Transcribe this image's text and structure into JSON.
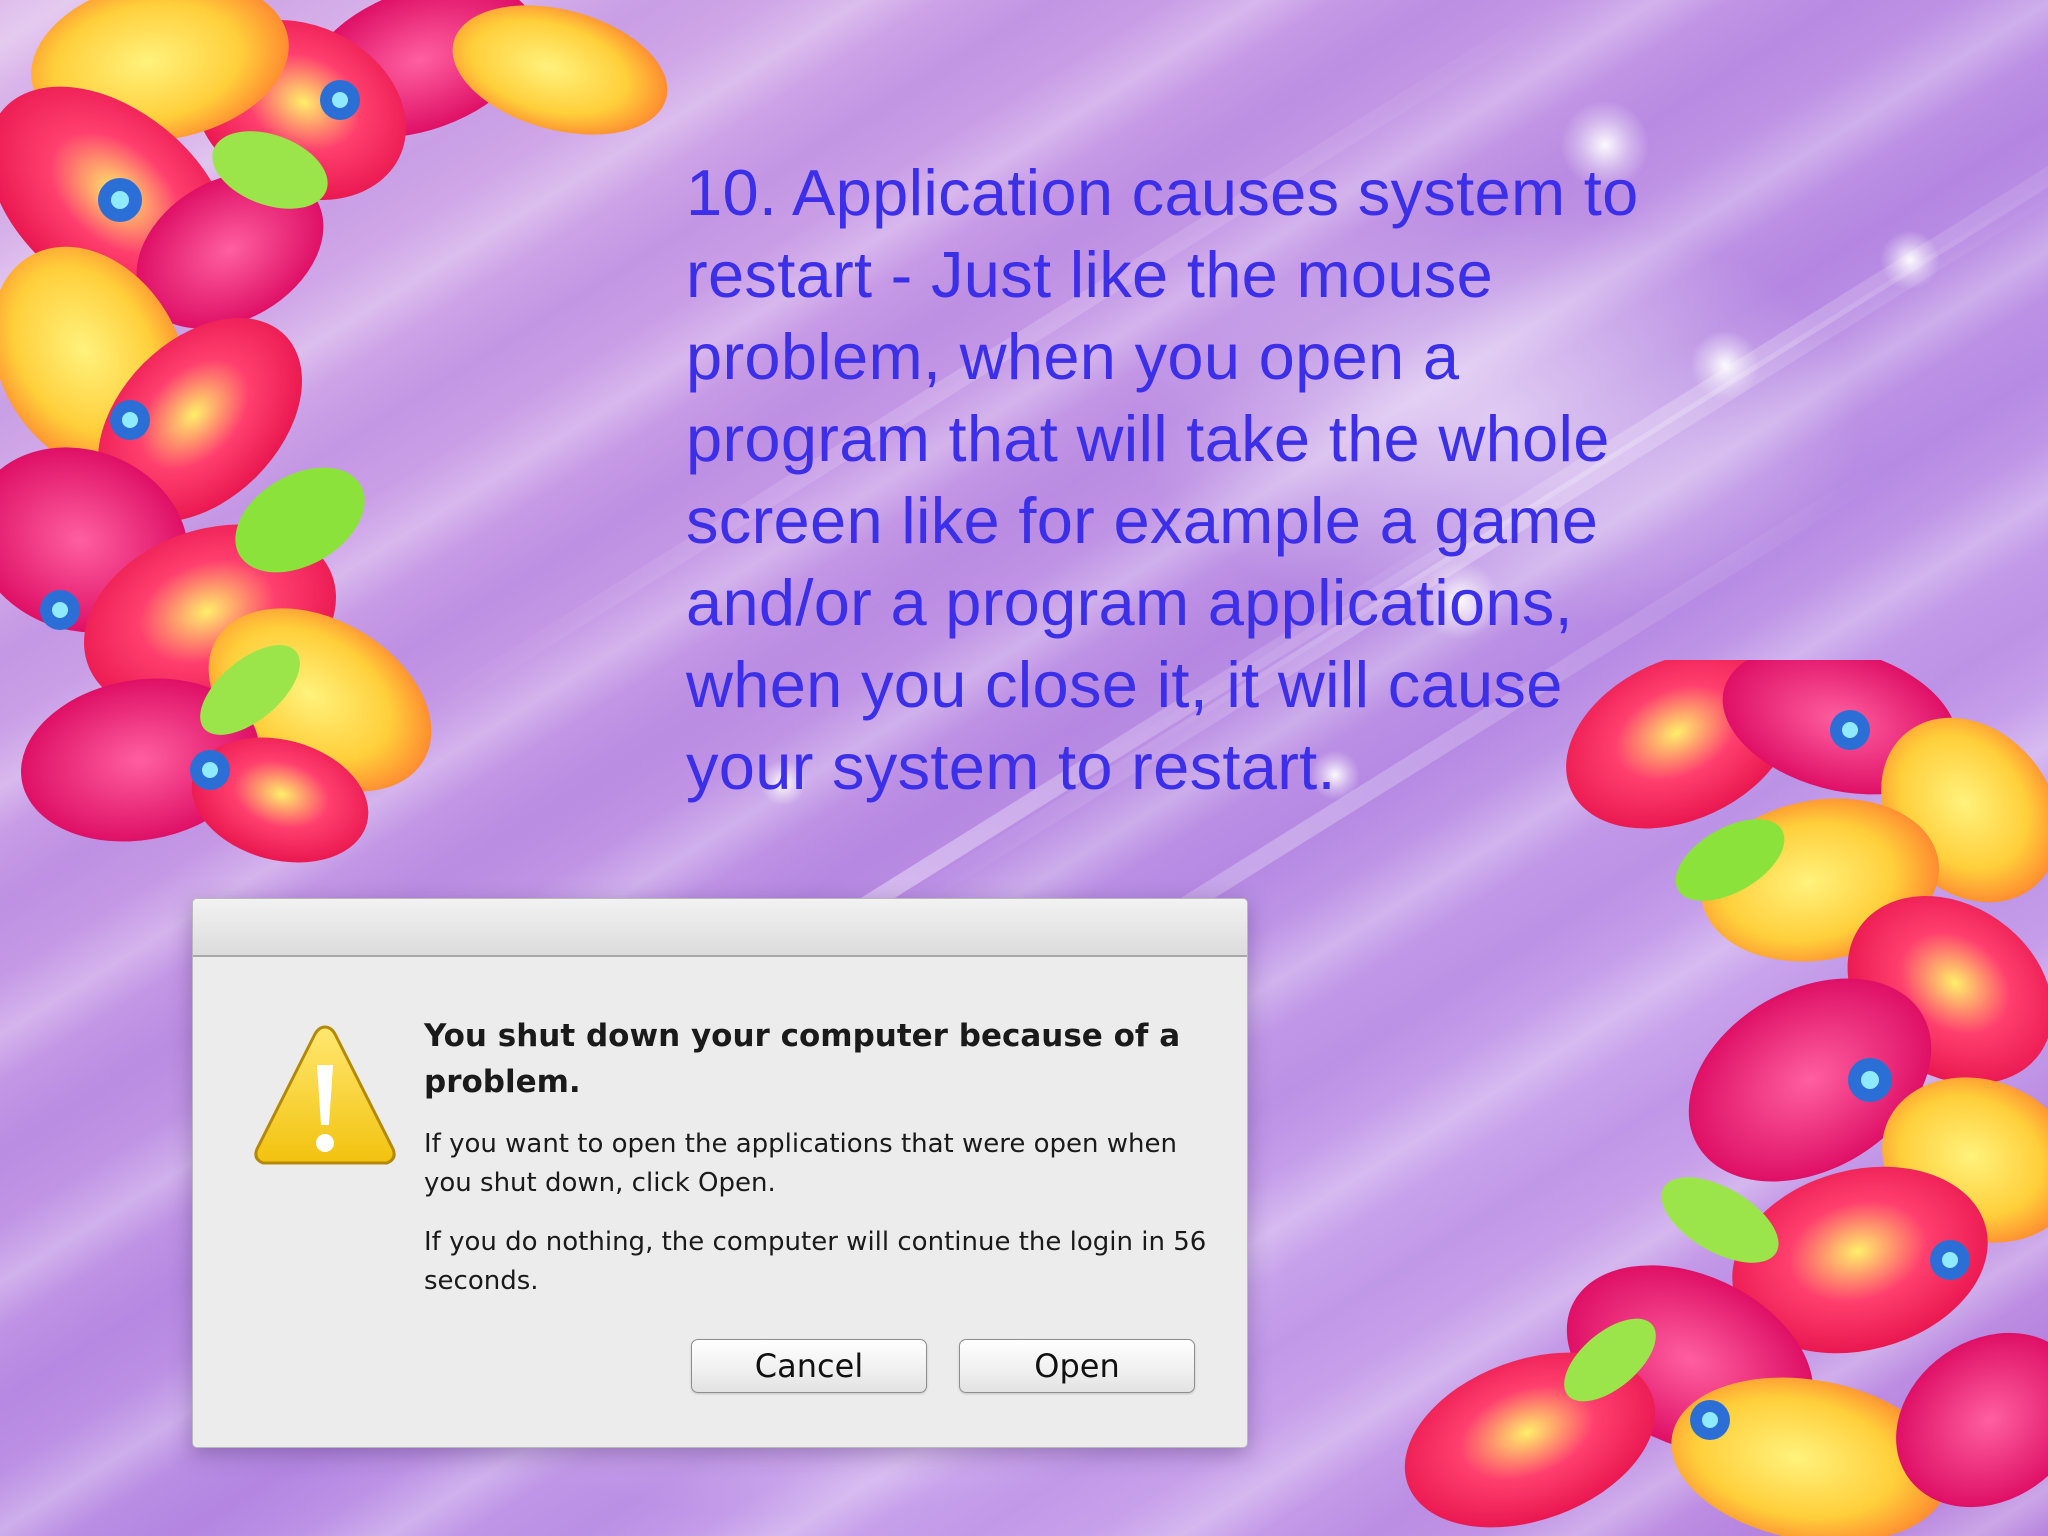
{
  "slide": {
    "body_text": "10. Application causes system to restart - Just like the mouse problem, when you open a program that will take the whole screen like for example a game and/or a program applications, when you close it, it will cause your system to restart."
  },
  "dialog": {
    "title": "You shut down your computer because of a problem.",
    "message_1": "If you want to open the applications that were open when you shut down, click Open.",
    "message_2": "If you do nothing, the computer will continue the login in 56 seconds.",
    "cancel_label": "Cancel",
    "open_label": "Open",
    "icon": "warning-icon"
  },
  "colors": {
    "body_text": "#3b2fe8",
    "background": "#c79ae6",
    "warning_yellow": "#f7d21c",
    "dialog_background": "#ececec"
  }
}
